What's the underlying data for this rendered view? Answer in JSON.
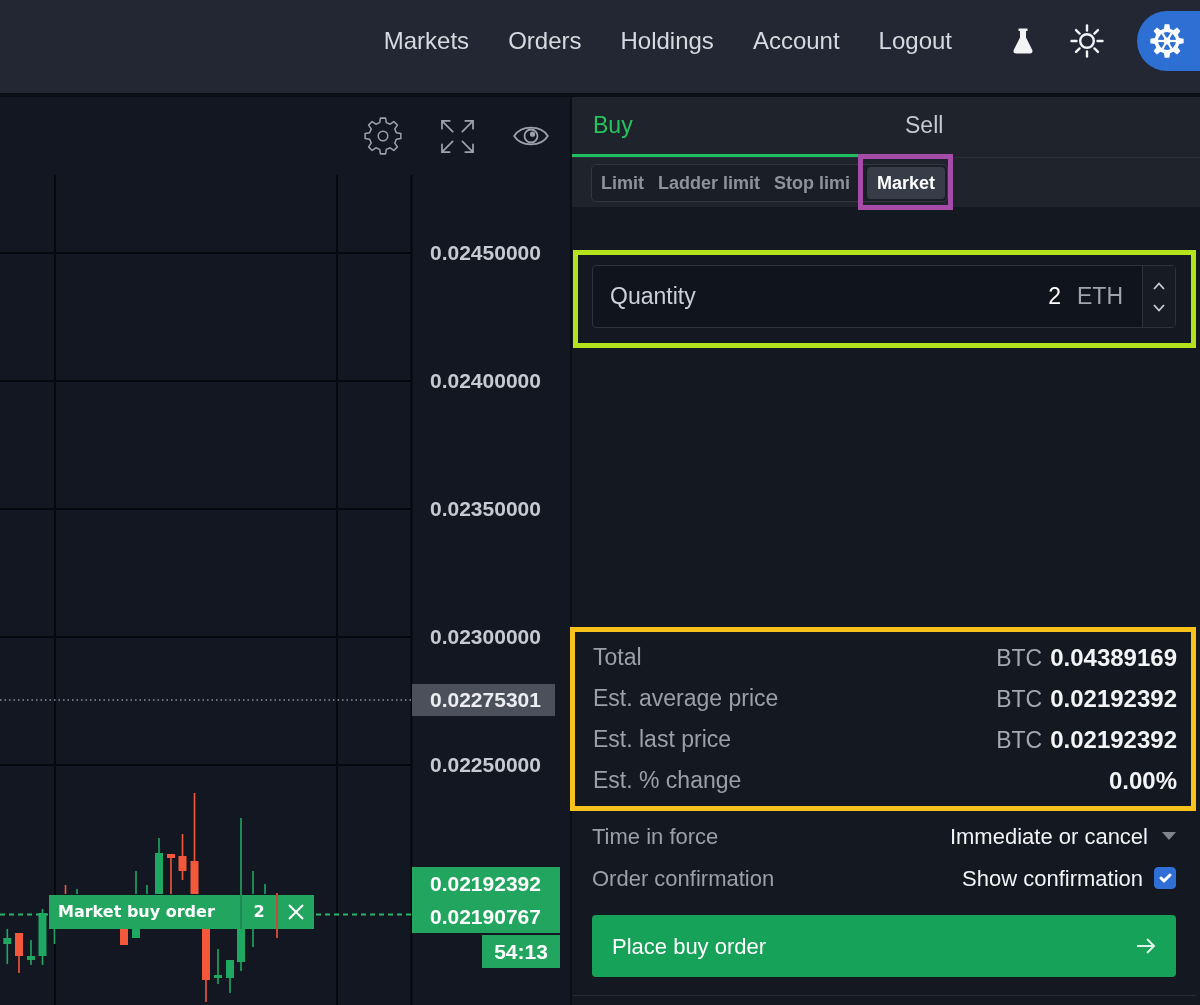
{
  "navbar": {
    "links": [
      "Markets",
      "Orders",
      "Holdings",
      "Account",
      "Logout"
    ]
  },
  "chart": {
    "axis_labels": [
      "0.02450000",
      "0.02400000",
      "0.02350000",
      "0.02300000",
      "0.02250000"
    ],
    "last_price": "0.02275301",
    "order_prices": [
      "0.02192392",
      "0.02190767"
    ],
    "countdown": "54:13",
    "order_tag": {
      "label": "Market buy order",
      "quantity": "2"
    }
  },
  "order_panel": {
    "sides": [
      {
        "label": "Buy",
        "selected": true
      },
      {
        "label": "Sell",
        "selected": false
      }
    ],
    "order_types": [
      {
        "label": "Limit",
        "selected": false,
        "highlighted": false
      },
      {
        "label": "Ladder limit",
        "selected": false,
        "highlighted": false
      },
      {
        "label": "Stop limi",
        "selected": false,
        "highlighted": false
      },
      {
        "label": "Market",
        "selected": true,
        "highlighted": true
      }
    ],
    "quantity": {
      "label": "Quantity",
      "value": "2",
      "unit": "ETH",
      "highlighted": true
    },
    "summary": {
      "highlighted": true,
      "rows": [
        {
          "label": "Total",
          "currency": "BTC",
          "value": "0.04389169"
        },
        {
          "label": "Est. average price",
          "currency": "BTC",
          "value": "0.02192392"
        },
        {
          "label": "Est. last price",
          "currency": "BTC",
          "value": "0.02192392"
        },
        {
          "label": "Est. % change",
          "value": "0.00%"
        }
      ]
    },
    "time_in_force": {
      "label": "Time in force",
      "value": "Immediate or cancel"
    },
    "order_confirmation": {
      "label": "Order confirmation",
      "option": "Show confirmation",
      "checked": true
    },
    "submit_button": {
      "label": "Place buy order"
    }
  }
}
